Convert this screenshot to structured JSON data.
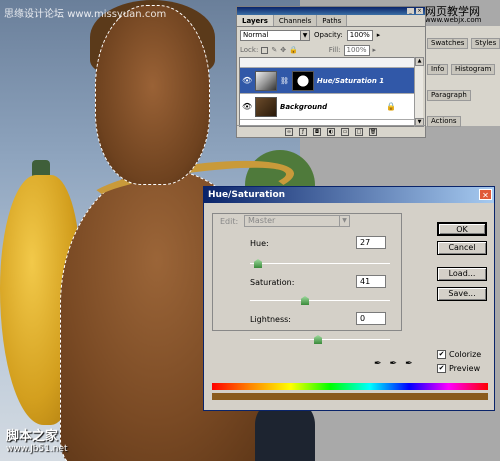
{
  "watermarks": {
    "top_left": "思缘设计论坛",
    "top_left_url": "www.missyuan.com",
    "top_right": "网页教学网",
    "top_right_url": "www.webjx.com",
    "bottom_left": "脚本之家",
    "bottom_left_url": "www.Jb51.net"
  },
  "layers_palette": {
    "tabs": [
      "Layers",
      "Channels",
      "Paths"
    ],
    "blend_mode": "Normal",
    "opacity_label": "Opacity:",
    "opacity_value": "100%",
    "lock_label": "Lock:",
    "fill_label": "Fill:",
    "fill_value": "100%",
    "layers": [
      {
        "name": "Hue/Saturation 1",
        "selected": true
      },
      {
        "name": "Background",
        "selected": false
      }
    ]
  },
  "side_palettes": {
    "tabs": [
      "Swatches",
      "Styles",
      "Info",
      "Histogram",
      "Paragraph",
      "Actions"
    ]
  },
  "dialog": {
    "title": "Hue/Saturation",
    "edit_label": "Edit:",
    "edit_value": "Master",
    "hue_label": "Hue:",
    "hue_value": "27",
    "saturation_label": "Saturation:",
    "saturation_value": "41",
    "lightness_label": "Lightness:",
    "lightness_value": "0",
    "buttons": {
      "ok": "OK",
      "cancel": "Cancel",
      "load": "Load...",
      "save": "Save..."
    },
    "colorize_label": "Colorize",
    "colorize_checked": true,
    "preview_label": "Preview",
    "preview_checked": true,
    "colorized_bar_color": "#8a5a1c"
  }
}
